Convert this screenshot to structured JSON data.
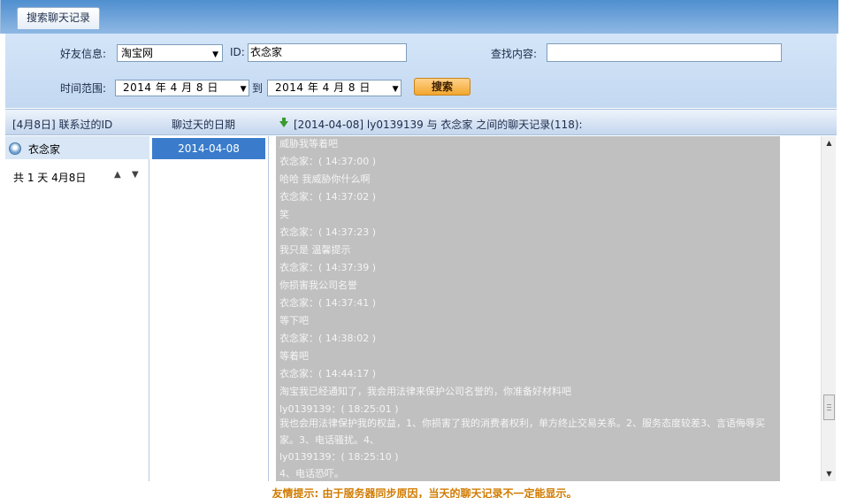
{
  "tab": {
    "label": "搜索聊天记录"
  },
  "form": {
    "friend_label": "好友信息:",
    "friend_value": "淘宝网",
    "id_label": "ID:",
    "id_value": "衣念家",
    "search_label": "查找内容:",
    "search_value": "",
    "range_label": "时间范围:",
    "date_from": "2014  年 4  月 8  日",
    "to_label": "到",
    "date_to": "2014  年 4  月 8  日",
    "search_button": "搜索"
  },
  "header": {
    "contacts": "[4月8日] 联系过的ID",
    "dates": "聊过天的日期",
    "log_title": "[2014-04-08] ly0139139 与 衣念家 之间的聊天记录(118):"
  },
  "contacts": {
    "items": [
      {
        "name": "衣念家"
      }
    ],
    "count_text": "共 1 天 4月8日"
  },
  "dates": {
    "items": [
      "2014-04-08"
    ]
  },
  "chat": {
    "lines": [
      "威胁我等着吧",
      "衣念家：( 14:37:00 )",
      "哈哈 我威胁你什么啊",
      "衣念家：( 14:37:02 )",
      "笑",
      "衣念家：( 14:37:23 )",
      "我只是 温馨提示",
      "衣念家：( 14:37:39 )",
      "你损害我公司名誉",
      "衣念家：( 14:37:41 )",
      "等下吧",
      "衣念家：( 14:38:02 )",
      "等着吧",
      "衣念家：( 14:44:17 )",
      "淘宝我已经通知了，我会用法律来保护公司名誉的，你准备好材料吧",
      "ly0139139：( 18:25:01 )",
      "我也会用法律保护我的权益，1、你损害了我的消费者权利，单方终止交易关系。2、服务态度较差3、言语侮辱买家。3、电话骚扰。4、",
      "ly0139139：( 18:25:10 )",
      "4、电话恐吓。"
    ]
  },
  "footer": {
    "tip": "友情提示: 由于服务器同步原因，当天的聊天记录不一定能显示。"
  }
}
